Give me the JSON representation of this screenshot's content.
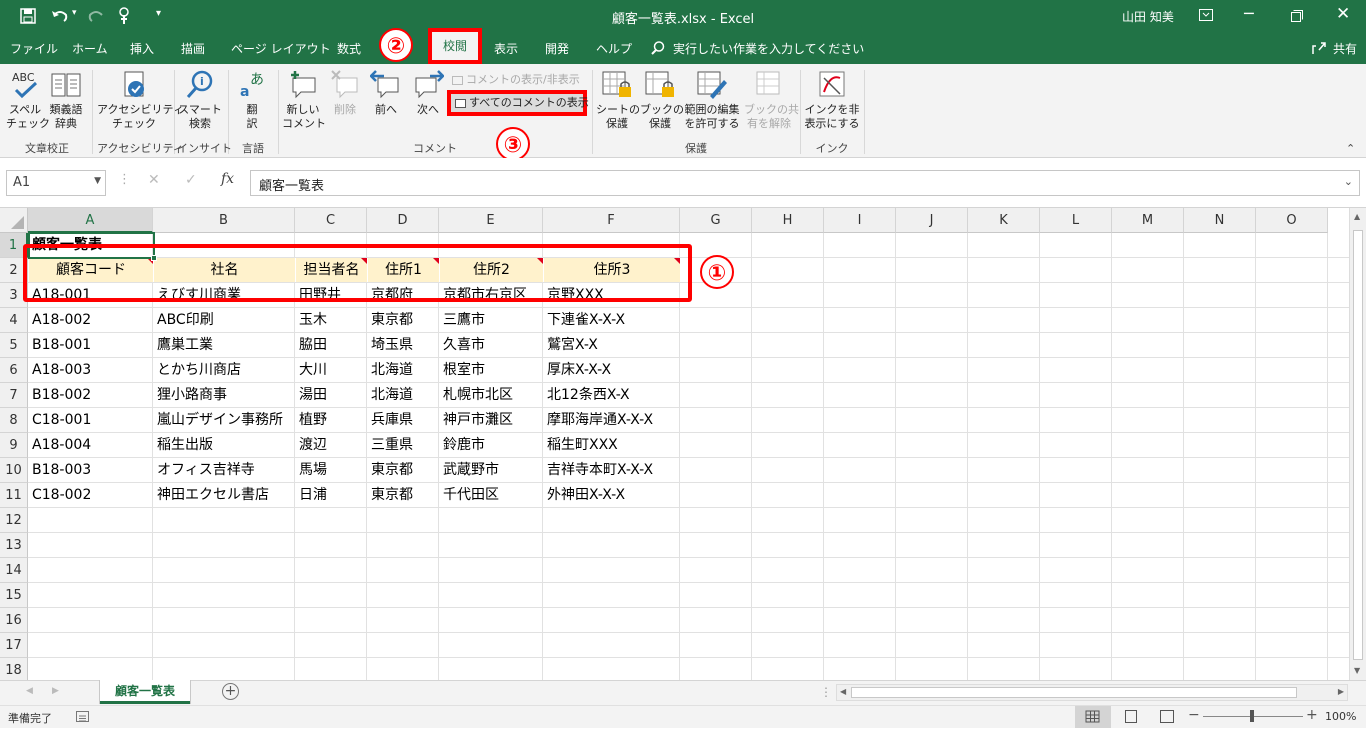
{
  "window": {
    "title": "顧客一覧表.xlsx  -  Excel",
    "user": "山田 知美"
  },
  "tabs": [
    "ファイル",
    "ホーム",
    "挿入",
    "描画",
    "ページ レイアウト",
    "数式",
    "校閲",
    "表示",
    "開発",
    "ヘルプ"
  ],
  "active_tab": "校閲",
  "tell_me": "実行したい作業を入力してください",
  "share": "共有",
  "ribbon": {
    "groups": [
      "文章校正",
      "アクセシビリティ",
      "インサイト",
      "言語",
      "コメント",
      "保護",
      "インク"
    ],
    "spelling": "スペル\nチェック",
    "thesaurus": "類義語\n辞典",
    "accessibility": "アクセシビリティ\nチェック",
    "smart_lookup": "スマート\n検索",
    "translate": "翻\n訳",
    "new_comment": "新しい\nコメント",
    "delete": "削除",
    "prev": "前へ",
    "next": "次へ",
    "show_hide_comment": "コメントの表示/非表示",
    "show_all_comments": "すべてのコメントの表示",
    "protect_sheet": "シートの\n保護",
    "protect_book": "ブックの\n保護",
    "allow_edit_ranges": "範囲の編集\nを許可する",
    "unshare_book": "ブックの共\n有を解除",
    "hide_ink": "インクを非\n表示にする"
  },
  "formula_bar": {
    "name_box": "A1",
    "content": "顧客一覧表"
  },
  "columns": [
    "A",
    "B",
    "C",
    "D",
    "E",
    "F",
    "G",
    "H",
    "I",
    "J",
    "K",
    "L",
    "M",
    "N",
    "O"
  ],
  "rows": [
    "1",
    "2",
    "3",
    "4",
    "5",
    "6",
    "7",
    "8",
    "9",
    "10",
    "11",
    "12",
    "13",
    "14",
    "15",
    "16",
    "17",
    "18"
  ],
  "sheet": {
    "title": "顧客一覧表",
    "headers": [
      "顧客コード",
      "社名",
      "担当者名",
      "住所1",
      "住所2",
      "住所3"
    ],
    "data": [
      [
        "A18-001",
        "えびす川商業",
        "田野井",
        "京都府",
        "京都市右京区",
        "京野XXX"
      ],
      [
        "A18-002",
        "ABC印刷",
        "玉木",
        "東京都",
        "三鷹市",
        "下連雀X-X-X"
      ],
      [
        "B18-001",
        "鷹巣工業",
        "脇田",
        "埼玉県",
        "久喜市",
        "鷲宮X-X"
      ],
      [
        "A18-003",
        "とかち川商店",
        "大川",
        "北海道",
        "根室市",
        "厚床X-X-X"
      ],
      [
        "B18-002",
        "狸小路商事",
        "湯田",
        "北海道",
        "札幌市北区",
        "北12条西X-X"
      ],
      [
        "C18-001",
        "嵐山デザイン事務所",
        "植野",
        "兵庫県",
        "神戸市灘区",
        "摩耶海岸通X-X-X"
      ],
      [
        "A18-004",
        "稲生出版",
        "渡辺",
        "三重県",
        "鈴鹿市",
        "稲生町XXX"
      ],
      [
        "B18-003",
        "オフィス吉祥寺",
        "馬場",
        "東京都",
        "武蔵野市",
        "吉祥寺本町X-X-X"
      ],
      [
        "C18-002",
        "神田エクセル書店",
        "日浦",
        "東京都",
        "千代田区",
        "外神田X-X-X"
      ]
    ]
  },
  "sheet_tab": "顧客一覧表",
  "status": {
    "ready": "準備完了",
    "zoom": "100%"
  },
  "annotations": {
    "one": "①",
    "two": "②",
    "three": "③"
  },
  "colors": {
    "excel_green": "#217346",
    "header_fill": "#fff2cc",
    "callout_red": "#ff0000",
    "comment_indicator": "#e0001b"
  }
}
